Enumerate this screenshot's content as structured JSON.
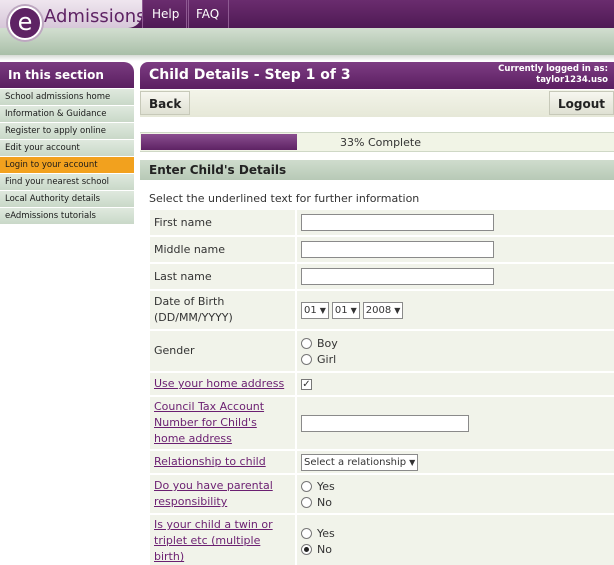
{
  "brand": {
    "logo_letter": "e",
    "name": "Admissions"
  },
  "nav": {
    "help": "Help",
    "faq": "FAQ"
  },
  "sidebar": {
    "title": "In this section",
    "items": [
      {
        "label": "School admissions home",
        "active": false
      },
      {
        "label": "Information & Guidance",
        "active": false
      },
      {
        "label": "Register to apply online",
        "active": false
      },
      {
        "label": "Edit your account",
        "active": false
      },
      {
        "label": "Login to your account",
        "active": true
      },
      {
        "label": "Find your nearest school",
        "active": false
      },
      {
        "label": "Local Authority details",
        "active": false
      },
      {
        "label": "eAdmissions tutorials",
        "active": false
      }
    ]
  },
  "page": {
    "title": "Child Details - Step 1 of 3",
    "logged_in_label": "Currently logged in as:",
    "username": "taylor1234.uso",
    "back_label": "Back",
    "logout_label": "Logout",
    "progress_text": "33% Complete",
    "progress_fraction": 0.33,
    "section_title": "Enter Child's Details",
    "instructions": "Select the underlined text for further information"
  },
  "form": {
    "first_name": {
      "label": "First name",
      "value": ""
    },
    "middle_name": {
      "label": "Middle name",
      "value": ""
    },
    "last_name": {
      "label": "Last name",
      "value": ""
    },
    "dob": {
      "label": "Date of Birth\n(DD/MM/YYYY)",
      "day": "01",
      "month": "01",
      "year": "2008"
    },
    "gender": {
      "label": "Gender",
      "options": [
        "Boy",
        "Girl"
      ]
    },
    "home_address": {
      "label": "Use your home address",
      "checked": true
    },
    "council_tax": {
      "label": "Council Tax Account Number for Child's home address",
      "value": ""
    },
    "relationship": {
      "label": "Relationship to child",
      "selected": "Select a relationship"
    },
    "parental": {
      "label": "Do you have parental responsibility",
      "options": [
        "Yes",
        "No"
      ]
    },
    "twin": {
      "label": "Is your child a twin or triplet etc (multiple birth)",
      "options": [
        "Yes",
        "No"
      ],
      "selected": "No"
    }
  }
}
